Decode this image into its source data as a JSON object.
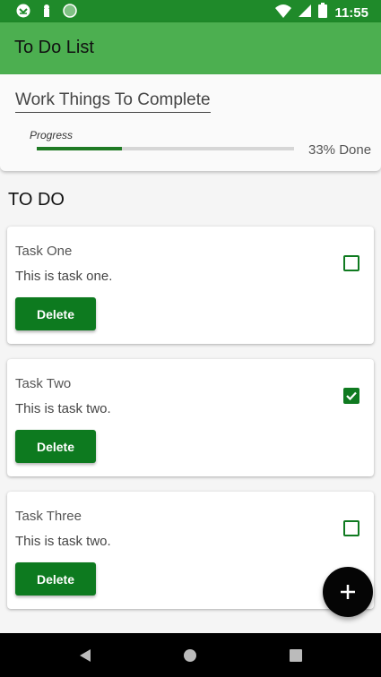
{
  "status_bar": {
    "time": "11:55",
    "icons": [
      "download-icon",
      "notification-icon",
      "sync-icon",
      "wifi-icon",
      "signal-icon",
      "battery-icon"
    ]
  },
  "app_bar": {
    "title": "To Do List"
  },
  "list_header": {
    "name": "Work Things To Complete",
    "progress_label": "Progress",
    "progress_fraction": 0.33,
    "progress_text": "33% Done"
  },
  "section": {
    "title": "TO DO"
  },
  "tasks": [
    {
      "title": "Task One",
      "description": "This is task one.",
      "checked": false,
      "delete_label": "Delete"
    },
    {
      "title": "Task Two",
      "description": "This is task two.",
      "checked": true,
      "delete_label": "Delete"
    },
    {
      "title": "Task Three",
      "description": "This is task two.",
      "checked": false,
      "delete_label": "Delete"
    }
  ],
  "fab": {
    "icon": "add-icon"
  },
  "nav": {
    "icons": [
      "back-icon",
      "home-icon",
      "recents-icon"
    ]
  },
  "colors": {
    "status_bar": "#1f8a2a",
    "app_bar": "#4caf50",
    "accent": "#0d7a1f"
  }
}
